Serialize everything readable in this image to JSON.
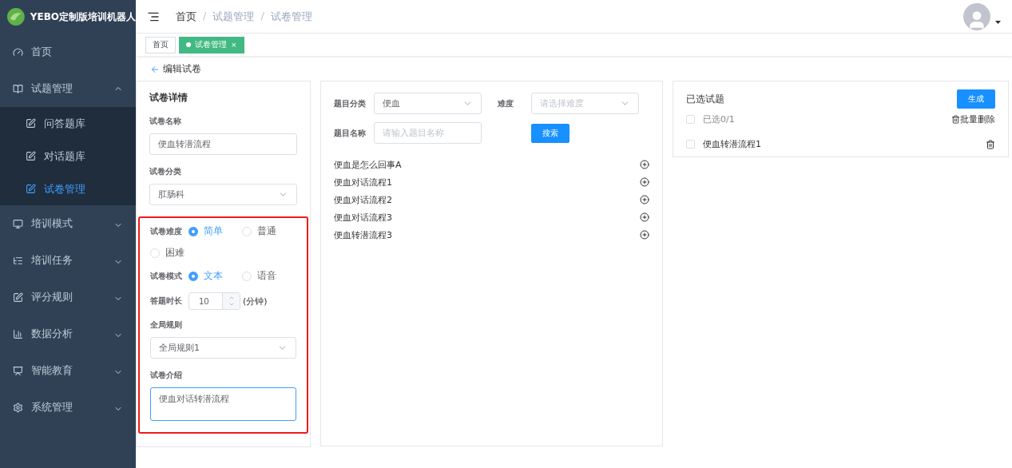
{
  "brand": {
    "title": "YEBO定制版培训机器人"
  },
  "sidebar": {
    "items": [
      {
        "label": "首页"
      },
      {
        "label": "试题管理",
        "expanded": true,
        "children": [
          {
            "label": "问答题库",
            "selected": false
          },
          {
            "label": "对话题库",
            "selected": false
          },
          {
            "label": "试卷管理",
            "selected": true
          }
        ]
      },
      {
        "label": "培训模式",
        "expanded": false
      },
      {
        "label": "培训任务",
        "expanded": false
      },
      {
        "label": "评分规则",
        "expanded": false
      },
      {
        "label": "数据分析",
        "expanded": false
      },
      {
        "label": "智能教育",
        "expanded": false
      },
      {
        "label": "系统管理",
        "expanded": false
      }
    ]
  },
  "breadcrumb": [
    {
      "label": "首页"
    },
    {
      "separator": "/",
      "label": "试题管理"
    },
    {
      "separator": "/",
      "label": "试卷管理"
    }
  ],
  "tabs": [
    {
      "label": "首页",
      "selected": false
    },
    {
      "label": "试卷管理",
      "selected": true,
      "close": "×"
    }
  ],
  "page_title": "编辑试卷",
  "details": {
    "title": "试卷详情",
    "name": {
      "label": "试卷名称",
      "value": "便血转潜流程"
    },
    "category": {
      "label": "试卷分类",
      "value": "肛肠科"
    },
    "difficulty": {
      "label": "试卷难度",
      "options": [
        {
          "label": "简单",
          "selected": true
        },
        {
          "label": "普通",
          "selected": false
        },
        {
          "label": "困难",
          "selected": false
        }
      ]
    },
    "mode": {
      "label": "试卷模式",
      "options": [
        {
          "label": "文本",
          "selected": true
        },
        {
          "label": "语音",
          "selected": false
        }
      ]
    },
    "duration": {
      "label": "答题时长",
      "value": "10",
      "unit": "(分钟)"
    },
    "rule": {
      "label": "全局规则",
      "value": "全局规则1"
    },
    "intro": {
      "label": "试卷介绍",
      "value": "便血对话转潜流程"
    }
  },
  "filter": {
    "category": {
      "label": "题目分类",
      "value": "便血"
    },
    "difficulty": {
      "label": "难度",
      "placeholder": "请选择难度"
    },
    "name": {
      "label": "题目名称",
      "placeholder": "请输入题目名称"
    },
    "search_button": "搜索"
  },
  "questions": [
    "便血是怎么回事A",
    "便血对话流程1",
    "便血对话流程2",
    "便血对话流程3",
    "便血转潜流程3"
  ],
  "selected_panel": {
    "title": "已选试题",
    "generate_button": "生成",
    "select_all": {
      "label": "已选0/1",
      "checked": false
    },
    "batch_delete": "批量删除",
    "items": [
      {
        "label": "便血转潜流程1",
        "checked": false
      }
    ]
  }
}
